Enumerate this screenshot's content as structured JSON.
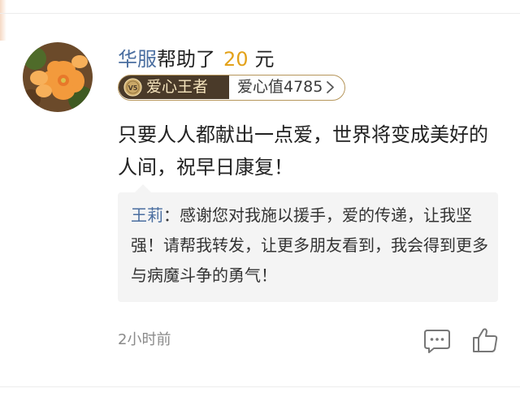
{
  "donation": {
    "donor_name": "华服",
    "action_text": "帮助了",
    "amount": "20",
    "unit": "元"
  },
  "badge": {
    "medal_text": "V5",
    "title": "爱心王者",
    "score_label": "爱心值4785",
    "icon": "chevron-right-icon"
  },
  "comment": {
    "text": "只要人人都献出一点爱，世界将变成美好的人间，祝早日康复！"
  },
  "reply": {
    "author": "王莉",
    "separator": "：",
    "text": "感谢您对我施以援手，爱的传递，让我坚强！请帮我转发，让更多朋友看到，我会得到更多与病魔斗争的勇气！"
  },
  "footer": {
    "timestamp": "2小时前",
    "comment_icon": "comment-icon",
    "like_icon": "thumbs-up-icon"
  },
  "colors": {
    "name_blue": "#4a6ea0",
    "amount_gold": "#e3a21a",
    "badge_dark": "#4a3a29",
    "badge_gold": "#b6965b",
    "reply_bg": "#f4f4f4"
  }
}
